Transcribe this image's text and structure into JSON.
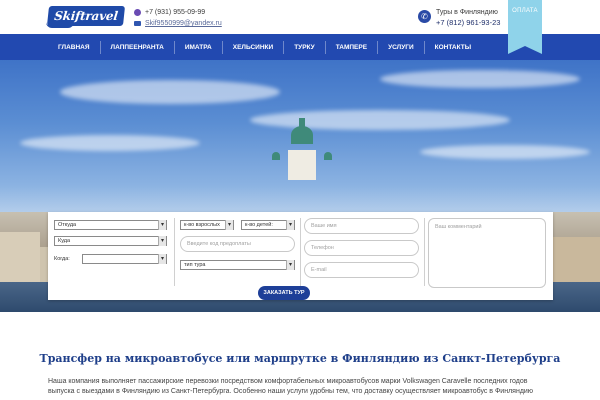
{
  "header": {
    "logo_text": "Skiftravel",
    "phone": "+7 (931) 955-09-99",
    "email": "Skif9550999@yandex.ru",
    "tours_label": "Туры в Финляндию",
    "tours_phone": "+7 (812) 961-93-23",
    "pay_label": "ОПЛАТА"
  },
  "nav": {
    "items": [
      "ГЛАВНАЯ",
      "ЛАППЕЕНРАНТА",
      "ИМАТРА",
      "ХЕЛЬСИНКИ",
      "ТУРКУ",
      "ТАМПЕРЕ",
      "УСЛУГИ",
      "КОНТАКТЫ"
    ]
  },
  "form": {
    "from": "Откуда",
    "to": "Куда",
    "when_label": "Когда:",
    "when_value": "",
    "adults": "к-во взрослых",
    "children": "к-во детей:",
    "promo_placeholder": "Введите код предоплаты",
    "tour_type": "тип тура",
    "name_placeholder": "Ваше имя",
    "phone_placeholder": "Телефон",
    "email_placeholder": "E-mail",
    "comment_placeholder": "Ваш комментарий",
    "submit": "ЗАКАЗАТЬ ТУР"
  },
  "content": {
    "title": "Трансфер на микроавтобусе или маршрутке в Финляндию из Санкт-Петербурга",
    "paragraph": "Наша компания выполняет пассажирские перевозки посредством комфортабельных микроавтобусов марки Volkswagen Caravelle последних годов выпуска с выездами в Финляндию из Санкт-Петербурга. Особенно наши услуги удобны тем, что доставку осуществляет микроавтобус в Финляндию"
  },
  "colors": {
    "nav_bg": "#2249b0",
    "accent": "#1e3f98",
    "pay_ribbon": "#8fd3ea",
    "title": "#1f3f8a"
  }
}
